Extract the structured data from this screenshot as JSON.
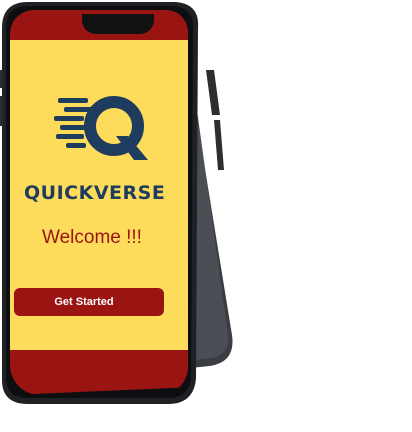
{
  "app": {
    "brand_name": "QUICKVERSE",
    "logo_letter": "Q"
  },
  "welcome": {
    "text": "Welcome !!!"
  },
  "cta": {
    "label": "Get Started"
  },
  "colors": {
    "primary": "#9a1412",
    "background": "#fddc5c",
    "brand_navy": "#1e3c5e"
  }
}
